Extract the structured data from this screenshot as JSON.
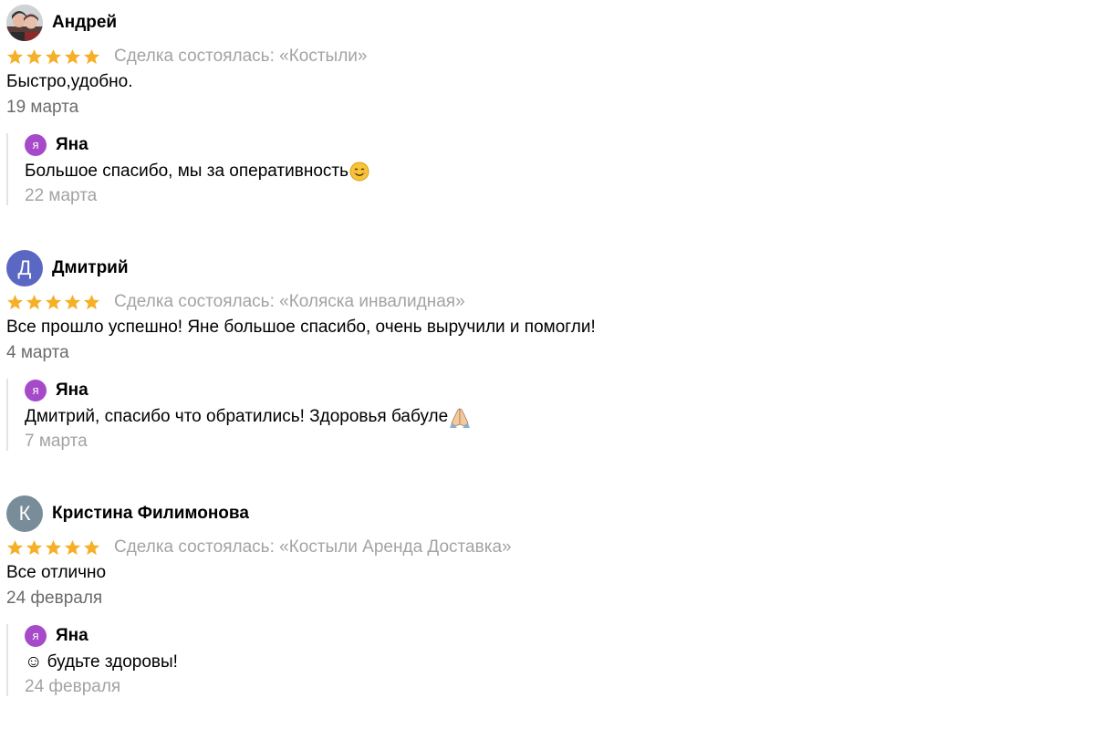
{
  "colors": {
    "star": "#f5b027",
    "reply_avatar": "#a64ac9",
    "avatar_dmitry": "#5b68c3",
    "avatar_kristina": "#788d99"
  },
  "reviews": [
    {
      "author": "Андрей",
      "avatar_type": "photo",
      "rating": 5,
      "deal": "Сделка состоялась: «Костыли»",
      "text": "Быстро,удобно.",
      "date": "19 марта",
      "reply": {
        "avatar_letter": "я",
        "name": "Яна",
        "text": "Большое спасибо, мы за оперативность",
        "emoji": "smiling-face-icon",
        "date": "22 марта"
      }
    },
    {
      "author": "Дмитрий",
      "avatar_letter": "Д",
      "rating": 5,
      "deal": "Сделка состоялась: «Коляска инвалидная»",
      "text": "Все прошло успешно! Яне большое спасибо, очень выручили и помогли!",
      "date": "4 марта",
      "reply": {
        "avatar_letter": "я",
        "name": "Яна",
        "text": "Дмитрий, спасибо что обратились! Здоровья бабуле",
        "emoji": "folded-hands-icon",
        "date": "7 марта"
      }
    },
    {
      "author": "Кристина Филимонова",
      "avatar_letter": "К",
      "rating": 5,
      "deal": "Сделка состоялась: «Костыли Аренда Доставка»",
      "text": "Все отлично",
      "date": "24 февраля",
      "reply": {
        "avatar_letter": "я",
        "name": "Яна",
        "text": "☺ будьте здоровы!",
        "date": "24 февраля"
      }
    }
  ]
}
